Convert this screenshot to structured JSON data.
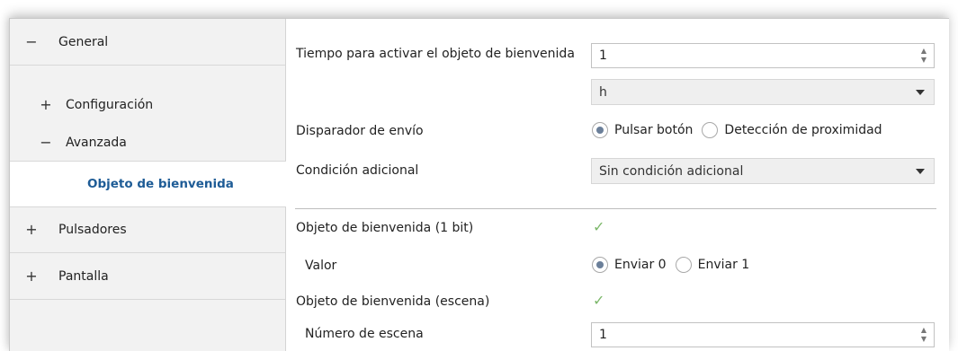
{
  "sidebar": {
    "items": [
      {
        "toggle": "−",
        "label": "General"
      },
      {
        "toggle": "+",
        "label": "Configuración"
      },
      {
        "toggle": "−",
        "label": "Avanzada"
      },
      {
        "toggle": "",
        "label": "Objeto de bienvenida"
      },
      {
        "toggle": "+",
        "label": "Pulsadores"
      },
      {
        "toggle": "+",
        "label": "Pantalla"
      }
    ]
  },
  "form": {
    "tiempo_label": "Tiempo para activar el objeto de bienvenida",
    "tiempo_value": "1",
    "unit_value": "h",
    "disparador_label": "Disparador de envío",
    "disparador_options": [
      "Pulsar botón",
      "Detección de proximidad"
    ],
    "condicion_label": "Condición adicional",
    "condicion_value": "Sin condición adicional",
    "obj1bit_label": "Objeto de bienvenida (1 bit)",
    "valor_label": "Valor",
    "valor_options": [
      "Enviar 0",
      "Enviar 1"
    ],
    "escena_label": "Objeto de bienvenida (escena)",
    "numero_escena_label": "Número de escena",
    "numero_escena_value": "1"
  },
  "icons": {
    "spin_up": "▲",
    "spin_down": "▼",
    "check": "✓"
  },
  "colors": {
    "active_link": "#1e5c96",
    "check_green": "#7cb86a",
    "radio_dot": "#6b7f99"
  }
}
